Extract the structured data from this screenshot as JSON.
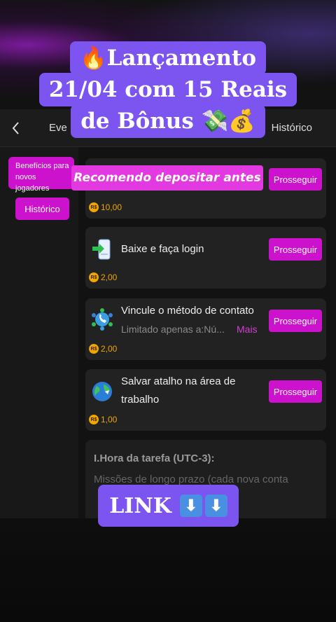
{
  "header": {
    "title": "Eve",
    "history_label": "Histórico"
  },
  "sidebar": {
    "tag_label": "Benefícios para novos jogadores",
    "history_button": "Histórico"
  },
  "tasks": [
    {
      "label": "",
      "action": "Prosseguir",
      "reward": "10,00"
    },
    {
      "label": "Baixe e faça login",
      "action": "Prosseguir",
      "reward": "2,00"
    },
    {
      "label": "Vincule o método de contato",
      "sub": "Limitado apenas a:Nú...",
      "more": "Mais",
      "action": "Prosseguir",
      "reward": "2,00"
    },
    {
      "label": "Salvar atalho na área de trabalho",
      "action": "Prosseguir",
      "reward": "1,00"
    }
  ],
  "currency_symbol": "R$",
  "info": {
    "title": "I.Hora da tarefa (UTC-3):",
    "text": "Missões de longo prazo (cada nova conta"
  },
  "overlay": {
    "line1": "🔥Lançamento",
    "line2": "21/04 com 15 Reais",
    "line3": "de Bônus 💸💰",
    "subtitle": "Recomendo depositar antes",
    "link": "LINK",
    "arrow": "⬇"
  },
  "colors": {
    "accent": "#cc12cc",
    "overlay": "#7c55f0",
    "reward": "#f0a500"
  }
}
